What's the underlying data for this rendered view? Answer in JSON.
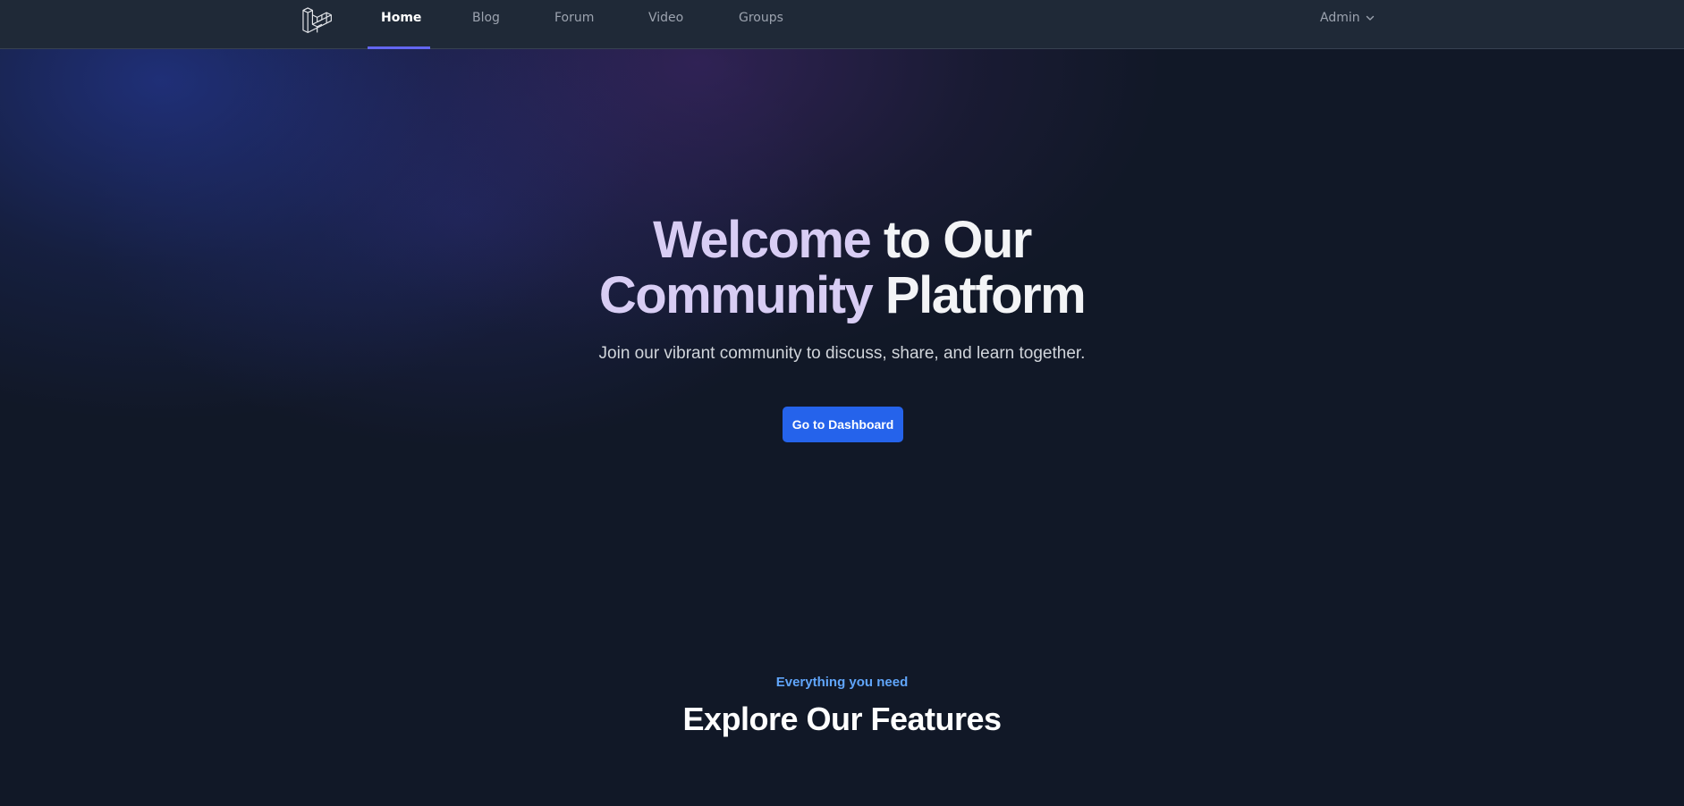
{
  "nav": {
    "items": [
      {
        "label": "Home",
        "active": true
      },
      {
        "label": "Blog",
        "active": false
      },
      {
        "label": "Forum",
        "active": false
      },
      {
        "label": "Video",
        "active": false
      },
      {
        "label": "Groups",
        "active": false
      }
    ],
    "user_menu": {
      "label": "Admin",
      "icon": "chevron-down-icon"
    },
    "logo_icon": "laravel-logo-icon",
    "active_underline_color": "#6366f1"
  },
  "hero": {
    "title_line1_accent": "Welcome",
    "title_line1_rest": " to Our",
    "title_line2_accent": "Community",
    "title_line2_rest": " Platform",
    "subtitle": "Join our vibrant community to discuss, share, and learn together.",
    "cta_label": "Go to Dashboard"
  },
  "features": {
    "eyebrow": "Everything you need",
    "title": "Explore Our Features"
  },
  "colors": {
    "background": "#111827",
    "navbar": "#1f2937",
    "primary_button": "#2563eb",
    "eyebrow_text": "#60a5fa",
    "title_accent": "#d8cdf4"
  }
}
